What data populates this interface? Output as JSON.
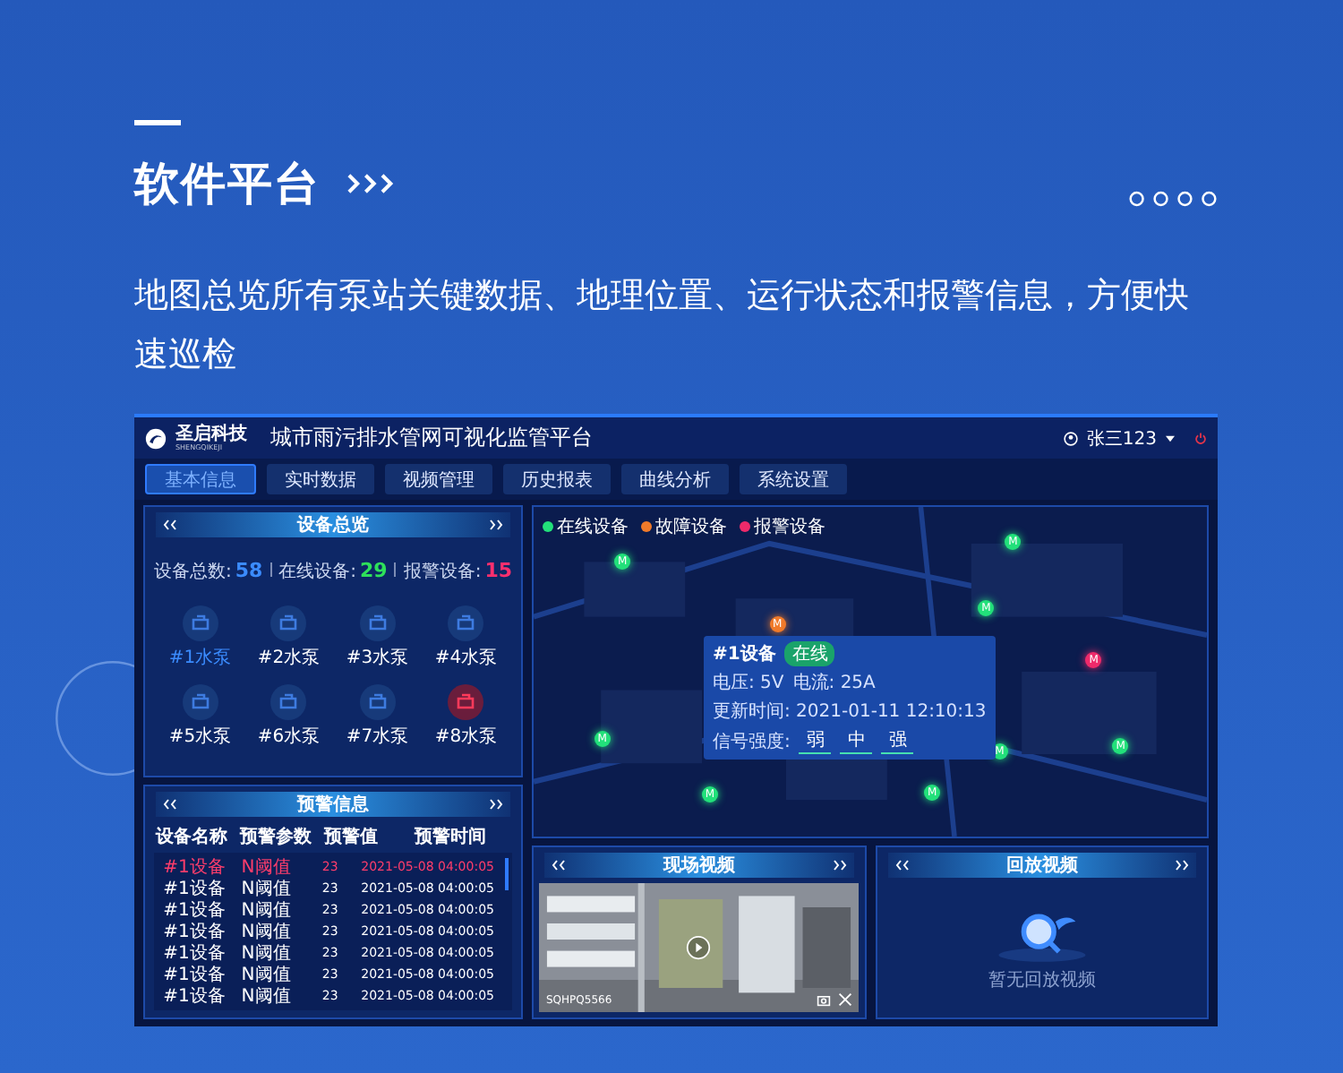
{
  "heading": {
    "title": "软件平台",
    "description": "地图总览所有泵站关键数据、地理位置、运行状态和报警信息，方便快速巡检"
  },
  "app": {
    "logo_name": "圣启科技",
    "logo_sub": "SHENGQIKEJI",
    "title": "城市雨污排水管网可视化监管平台",
    "user": "张三123",
    "nav": [
      {
        "label": "基本信息",
        "selected": true
      },
      {
        "label": "实时数据",
        "selected": false
      },
      {
        "label": "视频管理",
        "selected": false
      },
      {
        "label": "历史报表",
        "selected": false
      },
      {
        "label": "曲线分析",
        "selected": false
      },
      {
        "label": "系统设置",
        "selected": false
      }
    ],
    "overview": {
      "title": "设备总览",
      "stats": [
        {
          "label": "设备总数:",
          "value": "58",
          "color": "#3b8cff"
        },
        {
          "label": "在线设备:",
          "value": "29",
          "color": "#2ee05a"
        },
        {
          "label": "报警设备:",
          "value": "15",
          "color": "#ff2f6e"
        }
      ],
      "pumps": [
        {
          "label": "#1水泵",
          "selected": true,
          "alarm": false
        },
        {
          "label": "#2水泵",
          "selected": false,
          "alarm": false
        },
        {
          "label": "#3水泵",
          "selected": false,
          "alarm": false
        },
        {
          "label": "#4水泵",
          "selected": false,
          "alarm": false
        },
        {
          "label": "#5水泵",
          "selected": false,
          "alarm": false
        },
        {
          "label": "#6水泵",
          "selected": false,
          "alarm": false
        },
        {
          "label": "#7水泵",
          "selected": false,
          "alarm": false
        },
        {
          "label": "#8水泵",
          "selected": false,
          "alarm": true
        }
      ]
    },
    "alerts": {
      "title": "预警信息",
      "columns": [
        "设备名称",
        "预警参数",
        "预警值",
        "预警时间"
      ],
      "rows": [
        {
          "cells": [
            "#1设备",
            "N阈值",
            "23",
            "2021-05-08 04:00:05"
          ],
          "selected": true
        },
        {
          "cells": [
            "#1设备",
            "N阈值",
            "23",
            "2021-05-08 04:00:05"
          ],
          "selected": false
        },
        {
          "cells": [
            "#1设备",
            "N阈值",
            "23",
            "2021-05-08 04:00:05"
          ],
          "selected": false
        },
        {
          "cells": [
            "#1设备",
            "N阈值",
            "23",
            "2021-05-08 04:00:05"
          ],
          "selected": false
        },
        {
          "cells": [
            "#1设备",
            "N阈值",
            "23",
            "2021-05-08 04:00:05"
          ],
          "selected": false
        },
        {
          "cells": [
            "#1设备",
            "N阈值",
            "23",
            "2021-05-08 04:00:05"
          ],
          "selected": false
        },
        {
          "cells": [
            "#1设备",
            "N阈值",
            "23",
            "2021-05-08 04:00:05"
          ],
          "selected": false
        }
      ]
    },
    "map": {
      "legend": [
        {
          "label": "在线设备",
          "color": "#22e07a"
        },
        {
          "label": "故障设备",
          "color": "#f07a2a"
        },
        {
          "label": "报警设备",
          "color": "#ee2a6a"
        }
      ],
      "markers": [
        {
          "label": "M",
          "color": "#22e07a"
        },
        {
          "label": "M",
          "color": "#22e07a"
        },
        {
          "label": "M",
          "color": "#22e07a"
        },
        {
          "label": "M",
          "color": "#f07a2a"
        },
        {
          "label": "M",
          "color": "#ee2a6a"
        },
        {
          "label": "M",
          "color": "#22e07a"
        },
        {
          "label": "M",
          "color": "#22e07a"
        },
        {
          "label": "M",
          "color": "#22e07a"
        },
        {
          "label": "M",
          "color": "#22e07a"
        },
        {
          "label": "M",
          "color": "#22e07a"
        }
      ],
      "popup": {
        "device": "#1设备",
        "badge": "在线",
        "lines": [
          "电压: 5V",
          "电流: 25A"
        ],
        "time": "更新时间: 2021-01-11 12:10:13",
        "signal_label": "信号强度:",
        "signal": [
          "弱",
          "中",
          "强"
        ]
      }
    },
    "video": {
      "title": "现场视频",
      "camera": "SQHPQ5566"
    },
    "playback": {
      "title": "回放视频",
      "empty": "暂无回放视频"
    }
  }
}
